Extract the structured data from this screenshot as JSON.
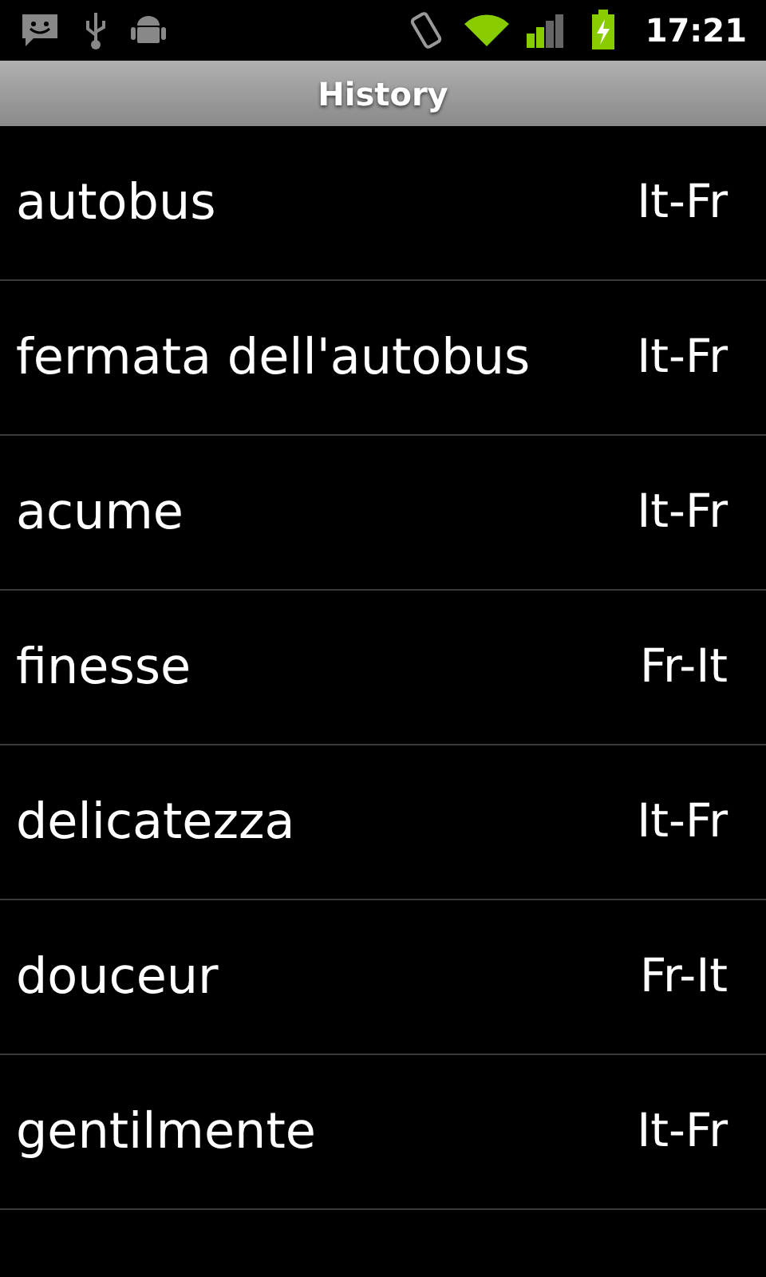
{
  "status_bar": {
    "time": "17:21"
  },
  "title": "History",
  "entries": [
    {
      "word": "autobus",
      "direction": "It-Fr"
    },
    {
      "word": "fermata dell'autobus",
      "direction": "It-Fr"
    },
    {
      "word": "acume",
      "direction": "It-Fr"
    },
    {
      "word": "finesse",
      "direction": "Fr-It"
    },
    {
      "word": "delicatezza",
      "direction": "It-Fr"
    },
    {
      "word": "douceur",
      "direction": "Fr-It"
    },
    {
      "word": "gentilmente",
      "direction": "It-Fr"
    }
  ]
}
